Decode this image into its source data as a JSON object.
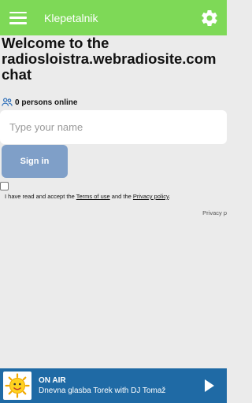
{
  "appbar": {
    "title": "Klepetalnik",
    "menu_icon": "hamburger-icon",
    "settings_icon": "gear-icon"
  },
  "welcome": {
    "line1": "Welcome to the",
    "line2": "radiosloistra.webradiosite.com",
    "line3": "chat"
  },
  "online": {
    "icon": "people-icon",
    "text": "0 persons online"
  },
  "form": {
    "name_placeholder": "Type your name",
    "signin_label": "Sign in",
    "terms_prefix": "I have read and accept the ",
    "terms_link": "Terms of use",
    "terms_mid": " and the ",
    "privacy_link": "Privacy policy",
    "terms_suffix": ".",
    "privacy_side_label": "Privacy p"
  },
  "player": {
    "status": "ON AIR",
    "track": "Dnevna glasba Torek with DJ Tomaž",
    "cover_icon": "sun-icon",
    "play_icon": "play-icon"
  },
  "colors": {
    "appbar": "#7ed957",
    "player": "#1f6aa5",
    "signin_button": "#7f9fc8",
    "background": "#ebebeb"
  }
}
